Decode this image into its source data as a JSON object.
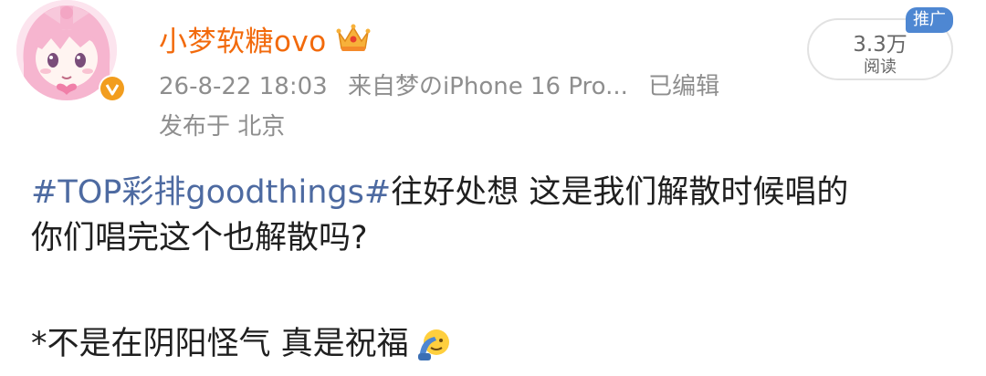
{
  "post": {
    "username": "小梦软糖ovo",
    "timestamp": "26-8-22 18:03",
    "source": "来自梦のiPhone 16 Pro...",
    "edited": "已编辑",
    "location": "发布于 北京",
    "hashtag": "#TOP彩排goodthings#",
    "text_line1": "往好处想 这是我们解散时候唱的",
    "text_line2": "你们唱完这个也解散吗?",
    "text_line3": "*不是在阴阳怪气 真是祝福"
  },
  "stats": {
    "read_count": "3.3万",
    "read_label": "阅读",
    "promo_tag": "推广"
  },
  "icons": {
    "avatar": "anime-girl-avatar",
    "verified": "orange-verified-v-icon",
    "member": "crown-icon",
    "emoji": "salute-emoji-icon"
  },
  "colors": {
    "username": "#f26a0c",
    "hashtag": "#4d6aa1",
    "meta": "#8e8e8e",
    "promo_bg": "#4e87d2",
    "verified": "#f29d1e"
  }
}
